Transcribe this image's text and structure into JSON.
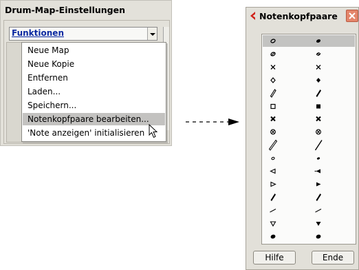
{
  "left_panel": {
    "title": "Drum-Map-Einstellungen",
    "select_label": "Funktionen",
    "menu_items": [
      "Neue Map",
      "Neue Kopie",
      "Entfernen",
      "Laden...",
      "Speichern...",
      "Notenkopfpaare bearbeiten...",
      "'Note anzeigen' initialisieren"
    ],
    "highlighted_item": "Notenkopfpaare bearbeiten..."
  },
  "dialog": {
    "title": "Notenkopfpaare",
    "rows": [
      [
        "open-oval-notehead-icon",
        "filled-oval-notehead-icon"
      ],
      [
        "slashed-open-notehead-icon",
        "slashed-filled-notehead-icon"
      ],
      [
        "x-notehead-icon",
        "x-notehead-icon"
      ],
      [
        "open-diamond-notehead-icon",
        "filled-diamond-notehead-icon"
      ],
      [
        "open-slash-notehead-icon",
        "filled-slash-notehead-icon"
      ],
      [
        "open-square-notehead-icon",
        "filled-square-notehead-icon"
      ],
      [
        "bold-x-notehead-icon",
        "bold-x-notehead-icon"
      ],
      [
        "circled-x-notehead-icon",
        "circled-x-notehead-icon"
      ],
      [
        "long-open-slash-notehead-icon",
        "long-thin-slash-notehead-icon"
      ],
      [
        "small-open-oval-notehead-icon",
        "small-filled-oval-notehead-icon"
      ],
      [
        "open-left-triangle-notehead-icon",
        "filled-left-triangle-notehead-icon"
      ],
      [
        "open-right-triangle-notehead-icon",
        "filled-right-triangle-notehead-icon"
      ],
      [
        "filled-slash-notehead-icon",
        "filled-slash-notehead-icon"
      ],
      [
        "thin-tick-notehead-icon",
        "thin-tick-notehead-icon"
      ],
      [
        "open-down-triangle-notehead-icon",
        "filled-down-triangle-notehead-icon"
      ],
      [
        "filled-round-notehead-icon",
        "filled-round-notehead-icon"
      ]
    ],
    "selected_row": 0,
    "buttons": {
      "help": "Hilfe",
      "done": "Ende"
    }
  },
  "colors": {
    "panel_bg": "#e3e1da",
    "link_blue": "#0b2aa2",
    "menu_highlight": "#c3c2c0",
    "close_button": "#e4856a",
    "title_icon_red": "#d0221a"
  }
}
